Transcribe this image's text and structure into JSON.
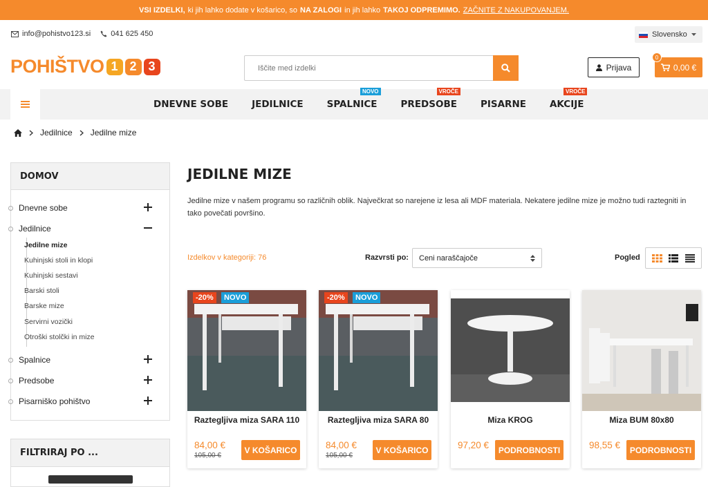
{
  "colors": {
    "accent": "#f58a2c",
    "badge_new": "#1a9ed9",
    "badge_hot": "#e8451d",
    "logo_one": "#f5a623",
    "logo_two": "#f58a2c",
    "logo_three": "#e8451d"
  },
  "topbar": {
    "part1": "VSI IZDELKI,",
    "part2": "ki jih lahko dodate v košarico, so",
    "part3": "NA ZALOGI",
    "part4": "in jih lahko",
    "part5": "TAKOJ ODPREMIMO.",
    "link": "ZAČNITE Z NAKUPOVANJEM."
  },
  "contact": {
    "email": "info@pohistvo123.si",
    "phone": "041 625 450"
  },
  "language": {
    "selected": "Slovensko"
  },
  "logo": {
    "word": "POHIŠTVO",
    "d1": "1",
    "d2": "2",
    "d3": "3"
  },
  "search": {
    "placeholder": "Iščite med izdelki"
  },
  "account": {
    "login_label": "Prijava"
  },
  "cart": {
    "count": "0",
    "total": "0,00 €"
  },
  "nav": {
    "items": [
      {
        "label": "DNEVNE SOBE",
        "badge": ""
      },
      {
        "label": "JEDILNICE",
        "badge": ""
      },
      {
        "label": "SPALNICE",
        "badge": "NOVO"
      },
      {
        "label": "PREDSOBE",
        "badge": "VROČE"
      },
      {
        "label": "PISARNE",
        "badge": ""
      },
      {
        "label": "AKCIJE",
        "badge": "VROČE"
      }
    ]
  },
  "breadcrumb": {
    "level1": "Jedilnice",
    "level2": "Jedilne mize"
  },
  "sidebar": {
    "title": "DOMOV",
    "categories": [
      {
        "label": "Dnevne sobe"
      },
      {
        "label": "Jedilnice"
      },
      {
        "label": "Spalnice"
      },
      {
        "label": "Predsobe"
      },
      {
        "label": "Pisarniško pohištvo"
      }
    ],
    "subcategories": [
      {
        "label": "Jedilne mize"
      },
      {
        "label": "Kuhinjski stoli in klopi"
      },
      {
        "label": "Kuhinjski sestavi"
      },
      {
        "label": "Barski stoli"
      },
      {
        "label": "Barske mize"
      },
      {
        "label": "Servirni vozički"
      },
      {
        "label": "Otroški stolčki in mize"
      }
    ],
    "filter_title": "FILTRIRAJ PO ..."
  },
  "main": {
    "title": "JEDILNE MIZE",
    "description": "Jedilne mize v našem programu so različnih oblik. Največkrat so narejene iz lesa ali MDF materiala. Nekatere jedilne mize je možno tudi raztegniti in tako povečati površino.",
    "count_label": "Izdelkov v kategoriji: 76",
    "sort_label": "Razvrsti po:",
    "sort_value": "Ceni naraščajoče",
    "view_label": "Pogled"
  },
  "products": [
    {
      "name": "Raztegljiva miza SARA 110",
      "price": "84,00 €",
      "old_price": "105,00 €",
      "discount": "-20%",
      "badge": "NOVO",
      "button": "V KOŠARICO"
    },
    {
      "name": "Raztegljiva miza SARA 80",
      "price": "84,00 €",
      "old_price": "105,00 €",
      "discount": "-20%",
      "badge": "NOVO",
      "button": "V KOŠARICO"
    },
    {
      "name": "Miza KROG",
      "price": "97,20 €",
      "button": "PODROBNOSTI"
    },
    {
      "name": "Miza BUM 80x80",
      "price": "98,55 €",
      "button": "PODROBNOSTI"
    }
  ]
}
